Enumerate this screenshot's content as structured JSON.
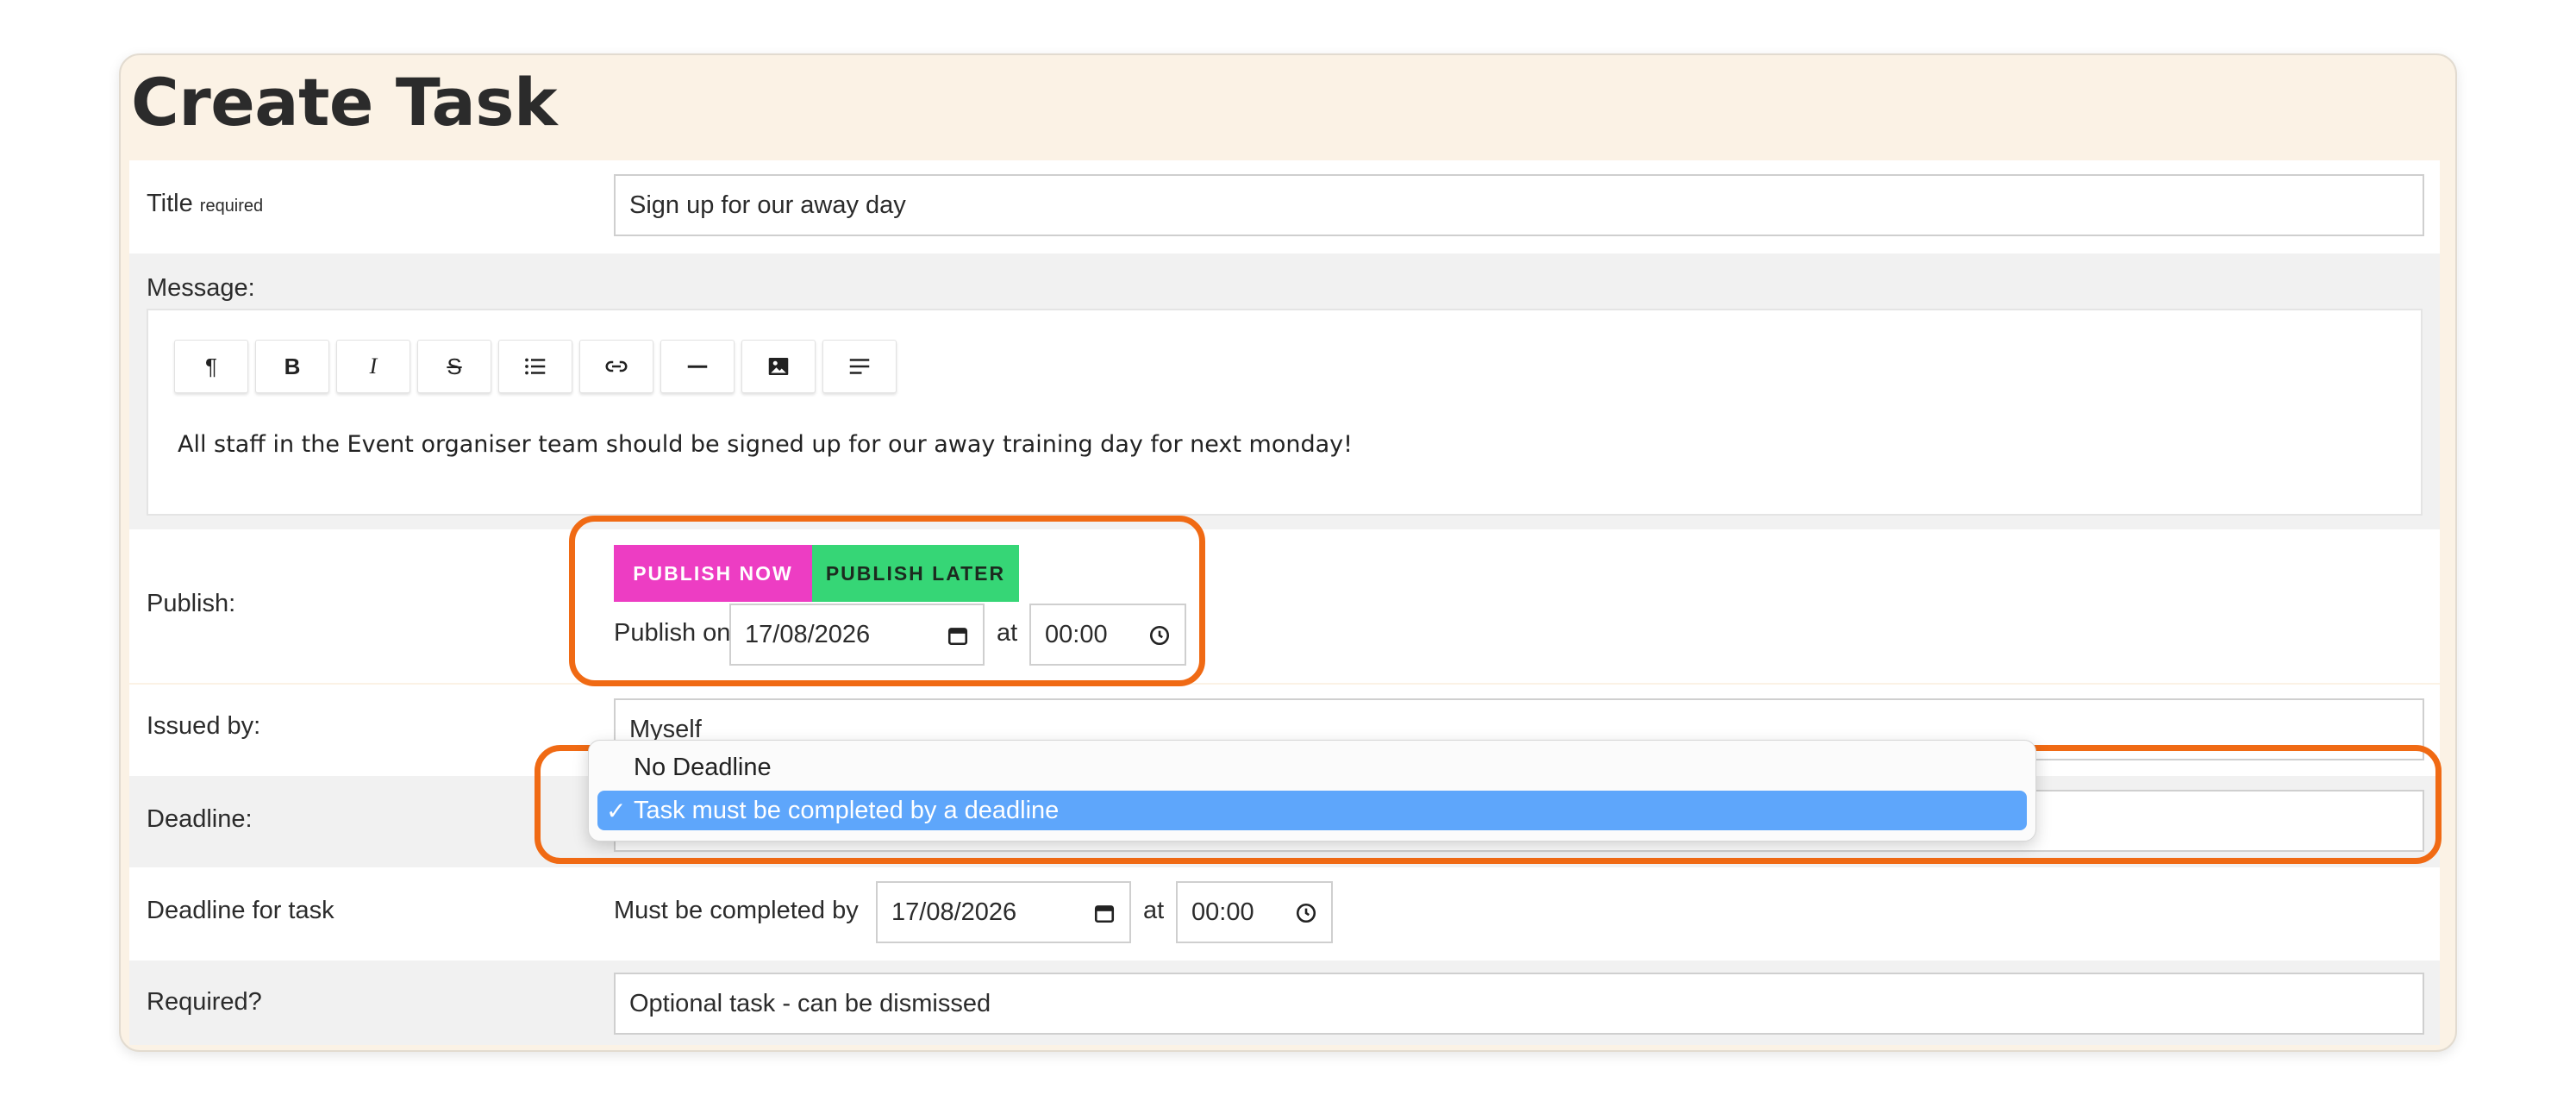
{
  "page": {
    "title": "Create Task"
  },
  "title_row": {
    "label": "Title",
    "required_note": "required",
    "value": "Sign up for our away day"
  },
  "message_row": {
    "label": "Message:",
    "toolbar": {
      "paragraph": "¶",
      "bold": "B",
      "italic": "I",
      "strikethrough": "S"
    },
    "body": "All staff in the Event organiser team should be signed up for our away training day for next monday!"
  },
  "publish_row": {
    "label": "Publish:",
    "publish_now": "PUBLISH NOW",
    "publish_later": "PUBLISH LATER",
    "publish_on_label": "Publish on",
    "date": "17/08/2026",
    "at_label": "at",
    "time": "00:00"
  },
  "issued_row": {
    "label": "Issued by:",
    "value": "Myself"
  },
  "deadline_row": {
    "label": "Deadline:",
    "options": [
      {
        "label": "No Deadline",
        "selected": false
      },
      {
        "label": "Task must be completed by a deadline",
        "selected": true
      }
    ],
    "check": "✓"
  },
  "deadline_task_row": {
    "label": "Deadline for task",
    "prefix": "Must be completed by",
    "date": "17/08/2026",
    "at_label": "at",
    "time": "00:00"
  },
  "required_row": {
    "label": "Required?",
    "value": "Optional task - can be dismissed"
  },
  "colors": {
    "publish_now": "#ed3dc3",
    "publish_later": "#36d676",
    "highlight": "#f06a14",
    "selected_option": "#5ea6fb",
    "card_bg": "#fbf2e5"
  }
}
